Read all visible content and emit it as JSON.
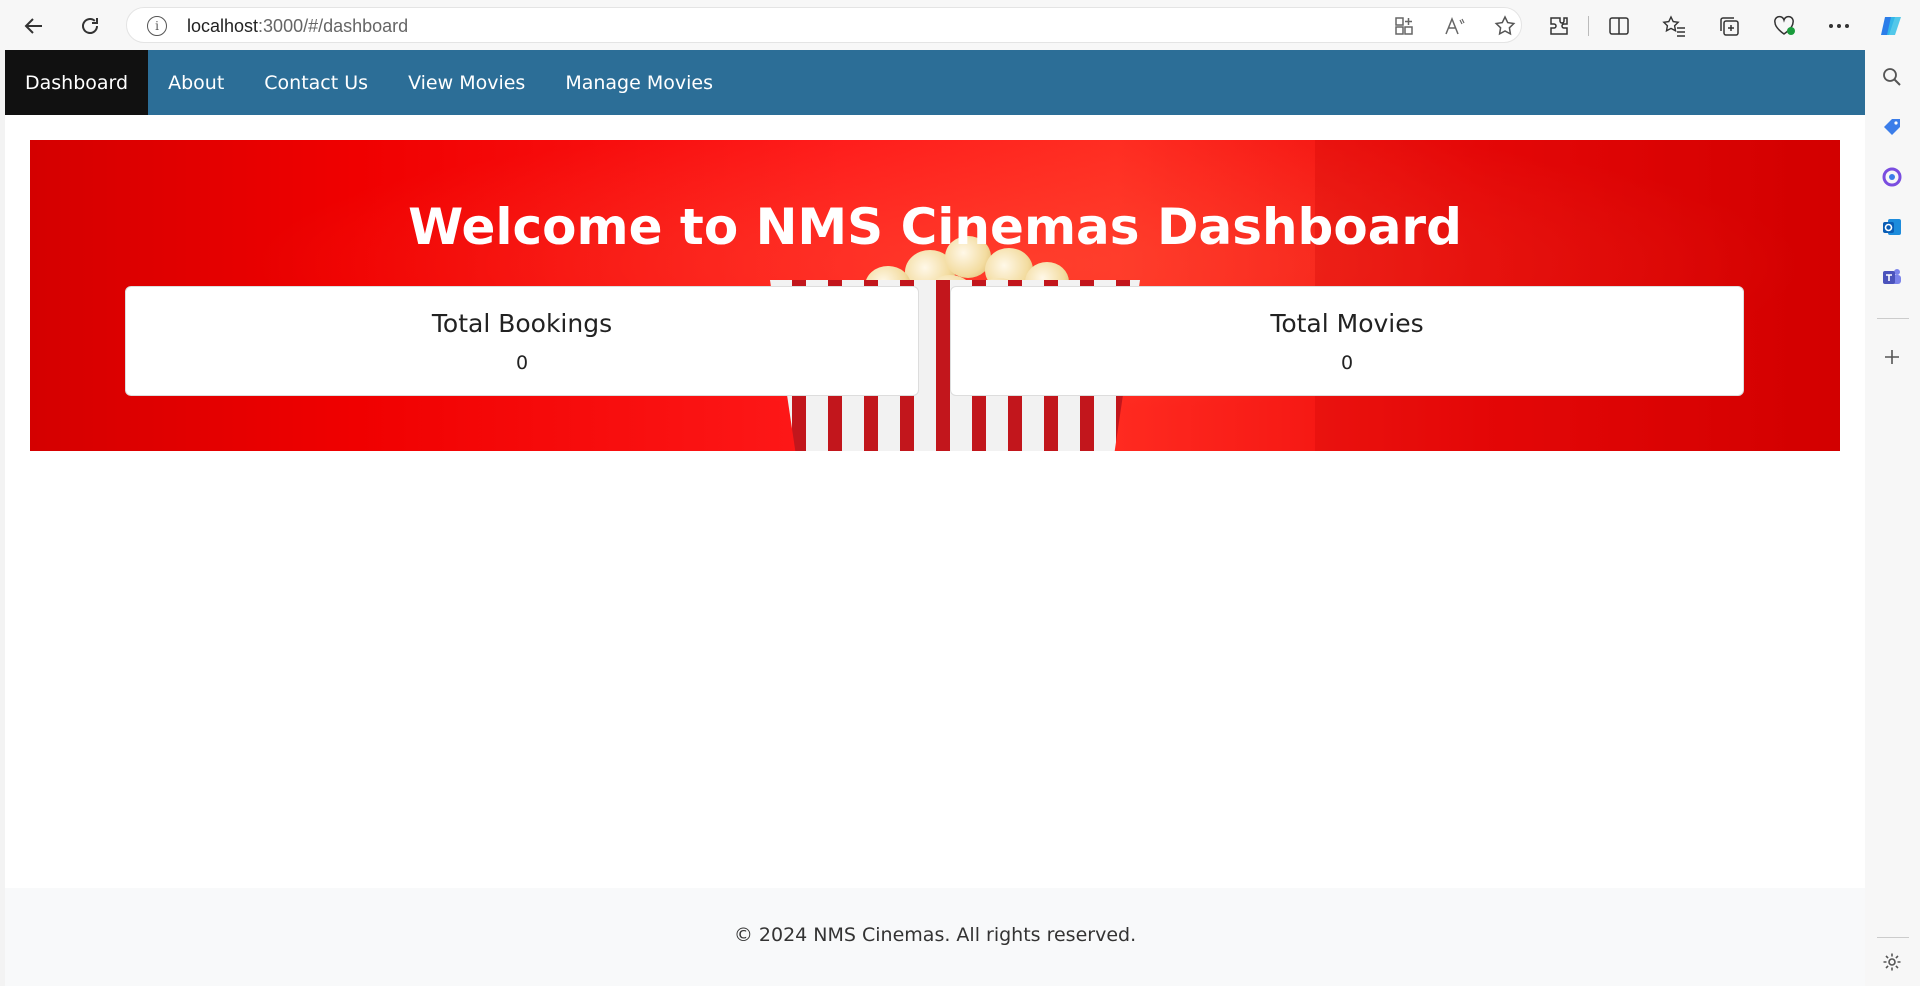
{
  "browser": {
    "url_host": "localhost",
    "url_rest": ":3000/#/dashboard",
    "icons": {
      "back": "back-arrow-icon",
      "refresh": "refresh-icon",
      "info": "info-icon",
      "app": "app-available-icon",
      "read_aloud": "read-aloud-icon",
      "favorite": "favorite-star-icon",
      "extensions": "extensions-icon",
      "split_screen": "split-screen-icon",
      "favorites": "favorites-icon",
      "collections": "collections-icon",
      "browser_essentials": "browser-essentials-icon",
      "more": "more-icon",
      "copilot": "copilot-icon"
    },
    "sidebar_icons": [
      "search-icon",
      "tag-icon",
      "copilot-side-icon",
      "outlook-icon",
      "teams-icon",
      "add-icon",
      "settings-icon"
    ]
  },
  "nav": {
    "items": [
      {
        "label": "Dashboard",
        "active": true
      },
      {
        "label": "About",
        "active": false
      },
      {
        "label": "Contact Us",
        "active": false
      },
      {
        "label": "View Movies",
        "active": false
      },
      {
        "label": "Manage Movies",
        "active": false
      }
    ]
  },
  "hero": {
    "title": "Welcome to NMS Cinemas Dashboard"
  },
  "stats": [
    {
      "title": "Total Bookings",
      "value": "0"
    },
    {
      "title": "Total Movies",
      "value": "0"
    }
  ],
  "footer": {
    "text": "© 2024 NMS Cinemas. All rights reserved."
  },
  "colors": {
    "nav_bg": "#2c6e97",
    "nav_active_bg": "#111111",
    "hero_red": "#f00000",
    "footer_bg": "#f8f9fa"
  }
}
